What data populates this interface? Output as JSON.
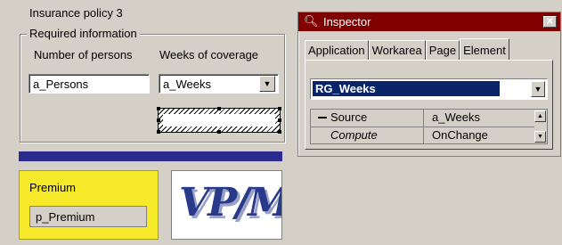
{
  "form": {
    "title": "Insurance policy 3",
    "group_label": "Required information",
    "persons_label": "Number of persons",
    "weeks_label": "Weeks of coverage",
    "persons_value": "a_Persons",
    "weeks_value": "a_Weeks"
  },
  "premium": {
    "label": "Premium",
    "value": "p_Premium"
  },
  "logo": {
    "text": "VP/MS"
  },
  "inspector": {
    "title": "Inspector",
    "tabs": [
      "Application",
      "Workarea",
      "Page",
      "Element"
    ],
    "active_tab": "Element",
    "element_value": "RG_Weeks",
    "properties": [
      {
        "name": "Source",
        "value": "a_Weeks"
      },
      {
        "name": "Compute",
        "value": "OnChange"
      }
    ]
  },
  "colors": {
    "titlebar": "#800000",
    "blue_bar": "#2c2c8e",
    "premium_bg": "#f5e92a",
    "selection": "#0a246a"
  }
}
